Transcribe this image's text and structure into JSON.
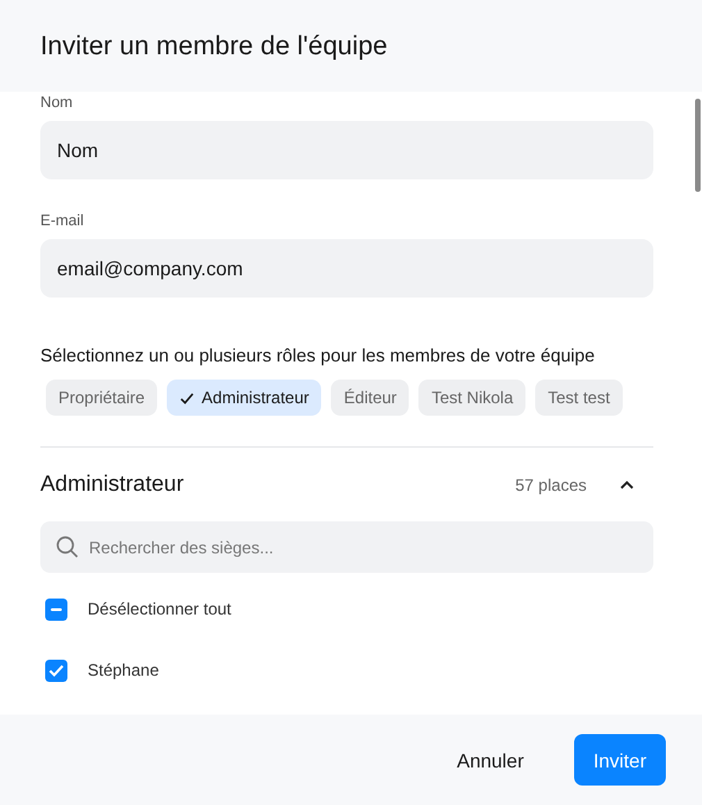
{
  "dialog": {
    "title": "Inviter un membre de l'équipe"
  },
  "fields": [
    {
      "label": "Nom",
      "value": "Nom"
    },
    {
      "label": "E-mail",
      "value": "email@company.com"
    }
  ],
  "roles_prompt": "Sélectionnez un ou plusieurs rôles pour les membres de votre équipe",
  "roles": [
    {
      "label": "Propriétaire",
      "selected": false
    },
    {
      "label": "Administrateur",
      "selected": true
    },
    {
      "label": "Éditeur",
      "selected": false
    },
    {
      "label": "Test Nikola",
      "selected": false
    },
    {
      "label": "Test test",
      "selected": false
    }
  ],
  "section": {
    "title": "Administrateur",
    "count": "57 places",
    "expanded": true,
    "search": {
      "placeholder": "Rechercher des sièges..."
    },
    "items": [
      {
        "label": "Désélectionner tout",
        "checked": true,
        "indeterminate": true
      },
      {
        "label": "Stéphane",
        "checked": true,
        "indeterminate": false
      }
    ]
  },
  "buttons": [
    {
      "label": "Annuler",
      "kind": "secondary"
    },
    {
      "label": "Inviter",
      "kind": "primary"
    }
  ]
}
